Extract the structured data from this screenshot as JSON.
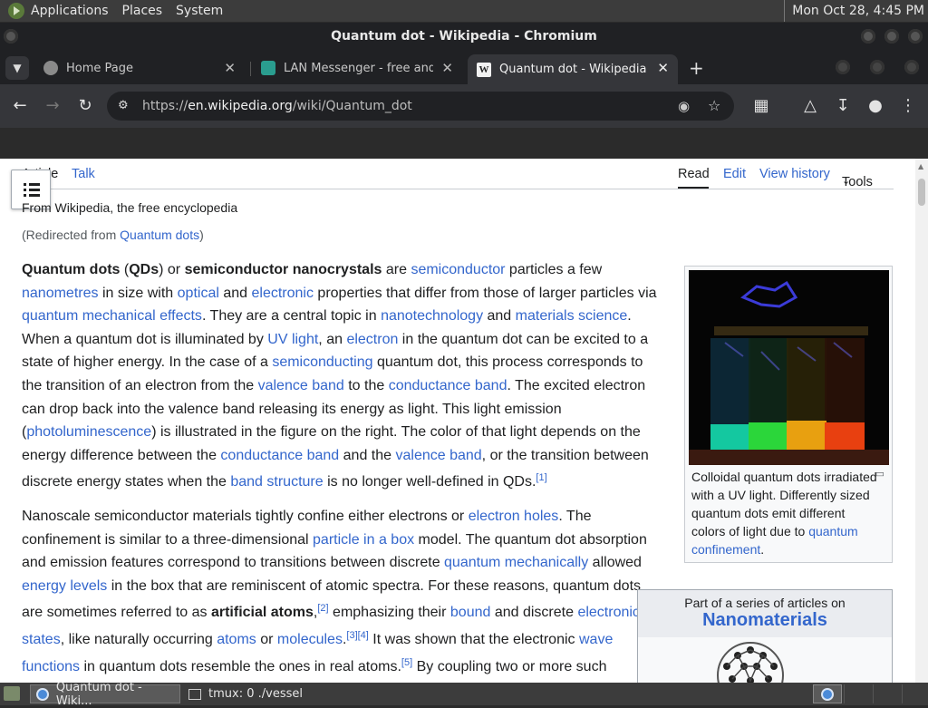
{
  "desktop": {
    "menus": [
      "Applications",
      "Places",
      "System"
    ],
    "clock": "Mon Oct 28,  4:45 PM"
  },
  "window": {
    "title": "Quantum dot - Wikipedia - Chromium"
  },
  "tabs": [
    {
      "label": "Home Page"
    },
    {
      "label": "LAN Messenger - free and op"
    },
    {
      "label": "Quantum dot - Wikipedia"
    }
  ],
  "toolbar": {
    "url_prefix": "https://",
    "url_host": "en.wikipedia.org",
    "url_path": "/wiki/Quantum_dot"
  },
  "page": {
    "nav_left": [
      "Article",
      "Talk"
    ],
    "nav_right": [
      "Read",
      "Edit",
      "View history",
      "Tools"
    ],
    "from_line": "From Wikipedia, the free encyclopedia",
    "redirect_prefix": "(Redirected from ",
    "redirect_link": "Quantum dots",
    "redirect_suffix": ")",
    "infobox_caption": "Colloidal quantum dots irradiated with a UV light. Differently sized quantum dots emit different colors of light due to ",
    "infobox_caption_link": "quantum confinement",
    "series_pre": "Part of a series of articles on",
    "series_title": "Nanomaterials"
  },
  "taskbar": {
    "tasks": [
      "Quantum dot - Wiki...",
      "tmux: 0 ./vessel"
    ]
  }
}
